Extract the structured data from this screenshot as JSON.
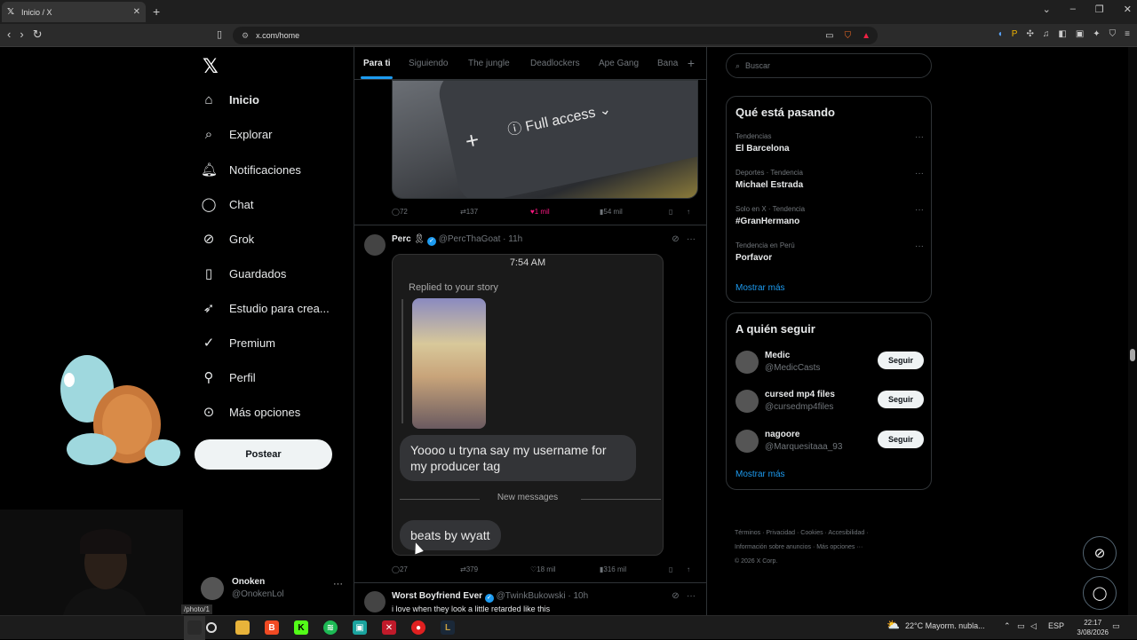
{
  "browser": {
    "tab_title": "Inicio / X",
    "tab_favicon": "x-logo-icon",
    "url": "x.com/home",
    "status_url": "/photo/1"
  },
  "sidebar": {
    "items": [
      {
        "label": "Inicio",
        "icon": "home-icon"
      },
      {
        "label": "Explorar",
        "icon": "search-icon"
      },
      {
        "label": "Notificaciones",
        "icon": "bell-icon"
      },
      {
        "label": "Chat",
        "icon": "chat-icon"
      },
      {
        "label": "Grok",
        "icon": "grok-icon"
      },
      {
        "label": "Guardados",
        "icon": "bookmark-icon"
      },
      {
        "label": "Estudio para crea...",
        "icon": "rocket-icon"
      },
      {
        "label": "Premium",
        "icon": "premium-icon"
      },
      {
        "label": "Perfil",
        "icon": "person-icon"
      },
      {
        "label": "Más opciones",
        "icon": "more-circle-icon"
      }
    ],
    "post_button": "Postear",
    "account": {
      "name": "Onoken",
      "handle": "@OnokenLol"
    }
  },
  "timeline": {
    "tabs": [
      "Para ti",
      "Siguiendo",
      "The jungle",
      "Deadlockers",
      "Ape Gang",
      "Bana"
    ],
    "tweet1": {
      "media_text": "Full access",
      "replies": "72",
      "reposts": "137",
      "likes": "1 mil",
      "views": "54 mil"
    },
    "tweet2": {
      "name": "Perc",
      "handle": "@PercThaGoat",
      "time": "11h",
      "dm_time": "7:54 AM",
      "replied_label": "Replied to your story",
      "message1": "Yoooo u tryna say my username for my producer tag",
      "new_messages": "New messages",
      "message2": "beats by wyatt",
      "replies": "27",
      "reposts": "379",
      "likes": "18 mil",
      "views": "316 mil"
    },
    "tweet3": {
      "name": "Worst Boyfriend Ever",
      "handle": "@TwinkBukowski",
      "time": "10h",
      "text": "i love when they look a little retarded like this"
    }
  },
  "right": {
    "search_placeholder": "Buscar",
    "trending_title": "Qué está pasando",
    "trends": [
      {
        "context": "Tendencias",
        "name": "El Barcelona"
      },
      {
        "context": "Deportes · Tendencia",
        "name": "Michael Estrada"
      },
      {
        "context": "Solo en X · Tendencia",
        "name": "#GranHermano"
      },
      {
        "context": "Tendencia en Perú",
        "name": "Porfavor"
      }
    ],
    "show_more": "Mostrar más",
    "follow_title": "A quién seguir",
    "follow": [
      {
        "name": "Medic",
        "handle": "@MedicCasts",
        "button": "Seguir"
      },
      {
        "name": "cursed mp4 files",
        "handle": "@cursedmp4files",
        "button": "Seguir"
      },
      {
        "name": "nagoore",
        "handle": "@Marquesitaaa_93",
        "button": "Seguir"
      }
    ],
    "footer_line1": "Términos · Privacidad · Cookies · Accesibilidad ·",
    "footer_line2": "Información sobre anuncios · Más opciones ···",
    "footer_line3": "© 2026 X Corp."
  },
  "taskbar": {
    "weather": "22°C  Mayorm. nubla...",
    "language": "ESP",
    "time": "22:17",
    "date": "3/08/2026"
  },
  "colors": {
    "accent": "#1d9bf0",
    "like": "#f91880",
    "background": "#000000"
  }
}
